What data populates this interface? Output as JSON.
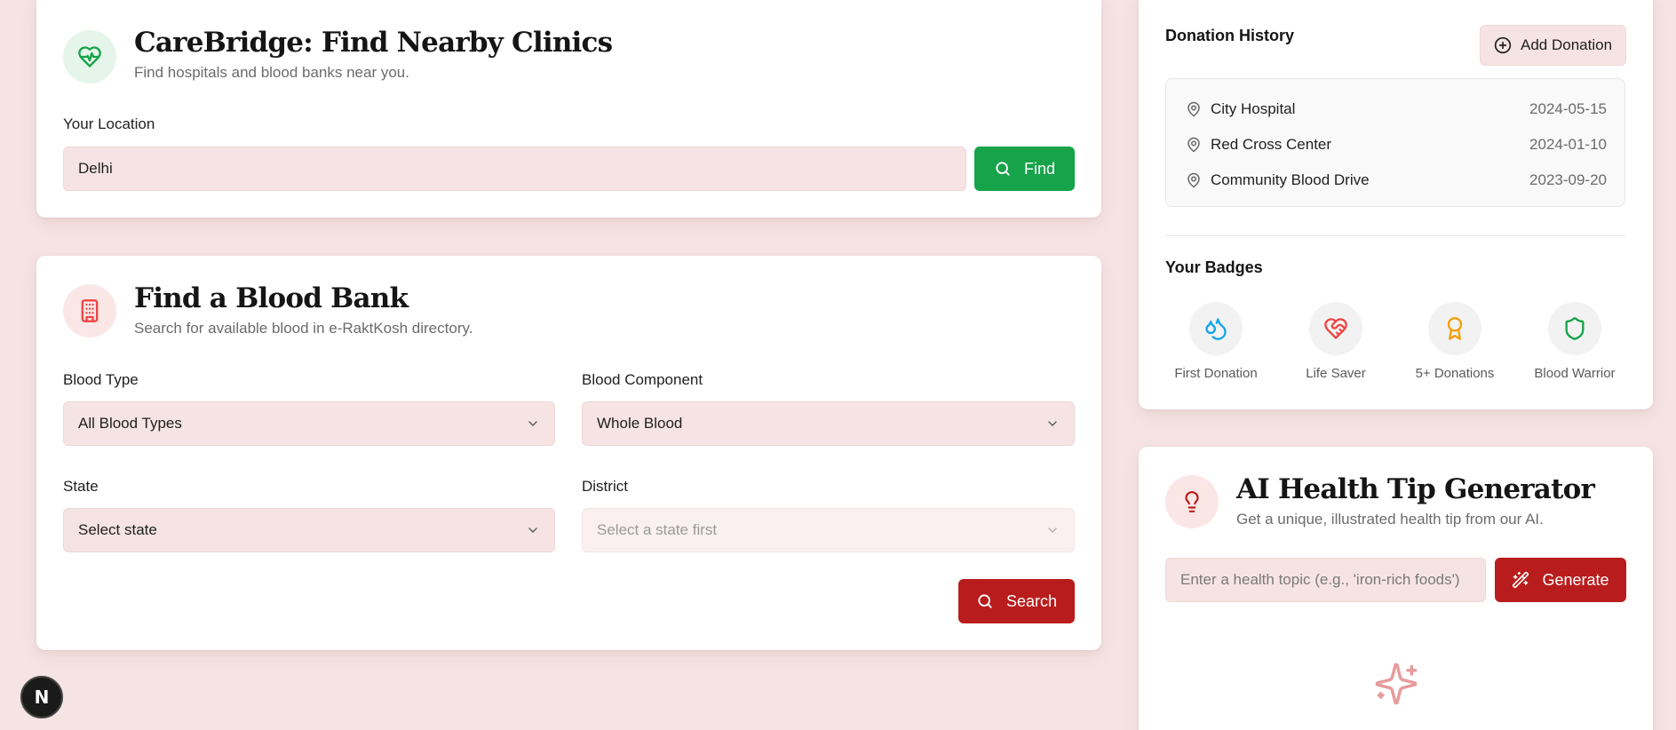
{
  "clinics": {
    "title": "CareBridge: Find Nearby Clinics",
    "subtitle": "Find hospitals and blood banks near you.",
    "location_label": "Your Location",
    "location_value": "Delhi",
    "find_label": "Find",
    "icon": "heart-pulse-icon"
  },
  "blood_bank": {
    "title": "Find a Blood Bank",
    "subtitle": "Search for available blood in e-RaktKosh directory.",
    "icon": "hospital-building-icon",
    "blood_type_label": "Blood Type",
    "blood_type_value": "All Blood Types",
    "component_label": "Blood Component",
    "component_value": "Whole Blood",
    "state_label": "State",
    "state_value": "Select state",
    "district_label": "District",
    "district_placeholder": "Select a state first",
    "search_label": "Search"
  },
  "donation_history": {
    "heading": "Donation History",
    "add_label": "Add Donation",
    "entries": [
      {
        "place": "City Hospital",
        "date": "2024-05-15"
      },
      {
        "place": "Red Cross Center",
        "date": "2024-01-10"
      },
      {
        "place": "Community Blood Drive",
        "date": "2023-09-20"
      }
    ]
  },
  "badges": {
    "heading": "Your Badges",
    "items": [
      {
        "label": "First Donation",
        "icon": "droplets-icon",
        "color": "#0ea5e9"
      },
      {
        "label": "Life Saver",
        "icon": "heart-handshake-icon",
        "color": "#ef4444"
      },
      {
        "label": "5+ Donations",
        "icon": "award-icon",
        "color": "#f59e0b"
      },
      {
        "label": "Blood Warrior",
        "icon": "shield-icon",
        "color": "#16a34a"
      }
    ]
  },
  "ai_tip": {
    "title": "AI Health Tip Generator",
    "subtitle": "Get a unique, illustrated health tip from our AI.",
    "placeholder": "Enter a health topic (e.g., 'iron-rich foods')",
    "generate_label": "Generate",
    "icon": "lightbulb-icon"
  },
  "colors": {
    "background": "#f6e4e4",
    "green": "#16a34a",
    "red": "#b91c1c"
  },
  "floating_button": {
    "label": "N"
  }
}
